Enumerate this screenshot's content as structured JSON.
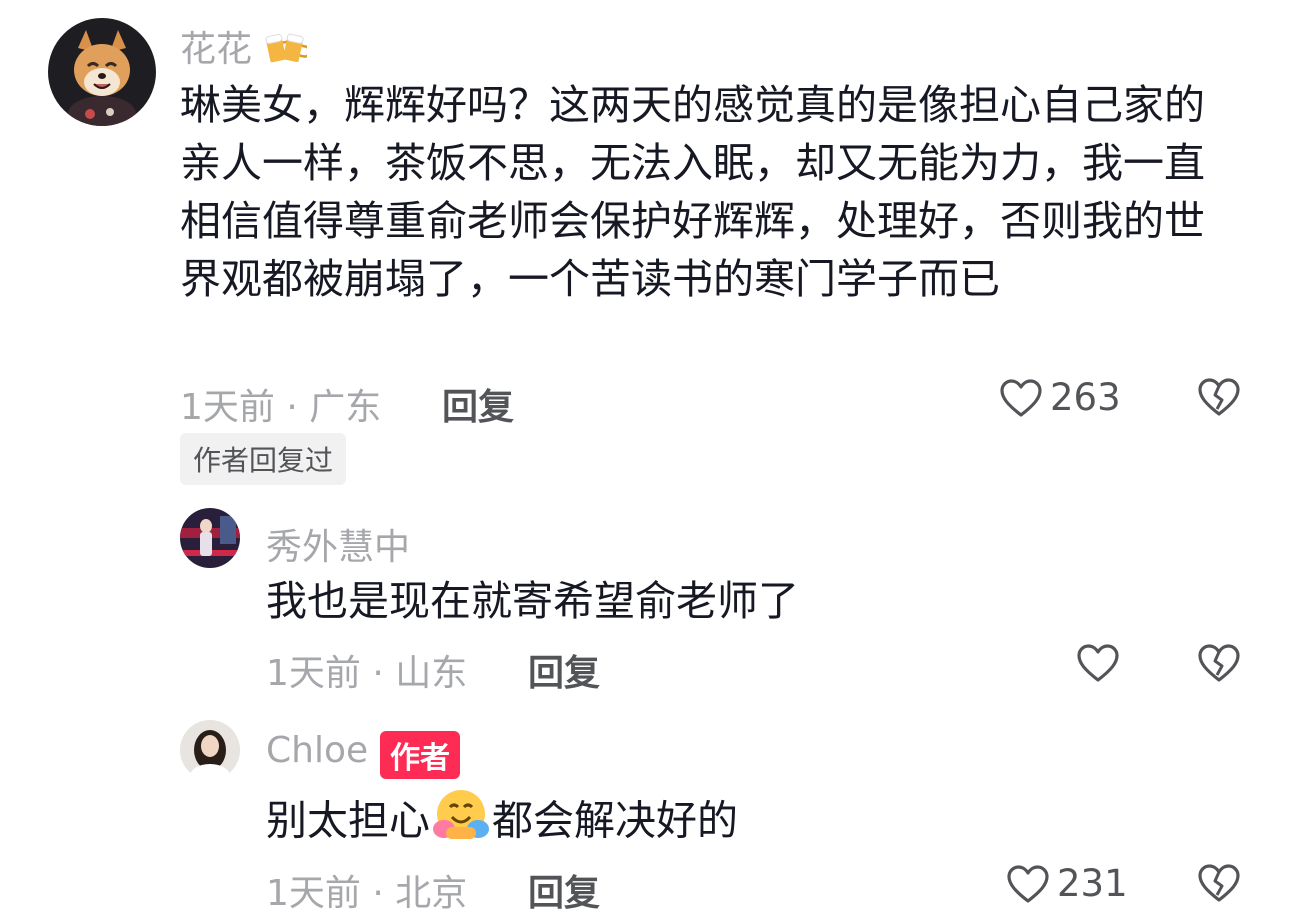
{
  "colors": {
    "accent": "#fe2c55",
    "muted": "#a6a7ab",
    "text": "#161823",
    "secondary": "#525458",
    "tag_bg": "#f1f1f2"
  },
  "comment": {
    "username": "花花",
    "username_icon": "beer-mugs-icon",
    "text": "琳美女，辉辉好吗？这两天的感觉真的是像担心自己家的亲人一样，茶饭不思，无法入眠，却又无能为力，我一直相信值得尊重俞老师会保护好辉辉，处理好，否则我的世界观都被崩塌了，一个苦读书的寒门学子而已",
    "meta": "1天前 · 广东",
    "reply_label": "回复",
    "like_count": "263",
    "author_replied_tag": "作者回复过"
  },
  "replies": [
    {
      "username": "秀外慧中",
      "text": "我也是现在就寄希望俞老师了",
      "meta": "1天前 · 山东",
      "reply_label": "回复",
      "like_count": ""
    },
    {
      "username": "Chloe",
      "author_badge": "作者",
      "text_before": "别太担心",
      "emoji": "hugging-face-icon",
      "text_after": "都会解决好的",
      "meta": "1天前 · 北京",
      "reply_label": "回复",
      "like_count": "231"
    }
  ]
}
